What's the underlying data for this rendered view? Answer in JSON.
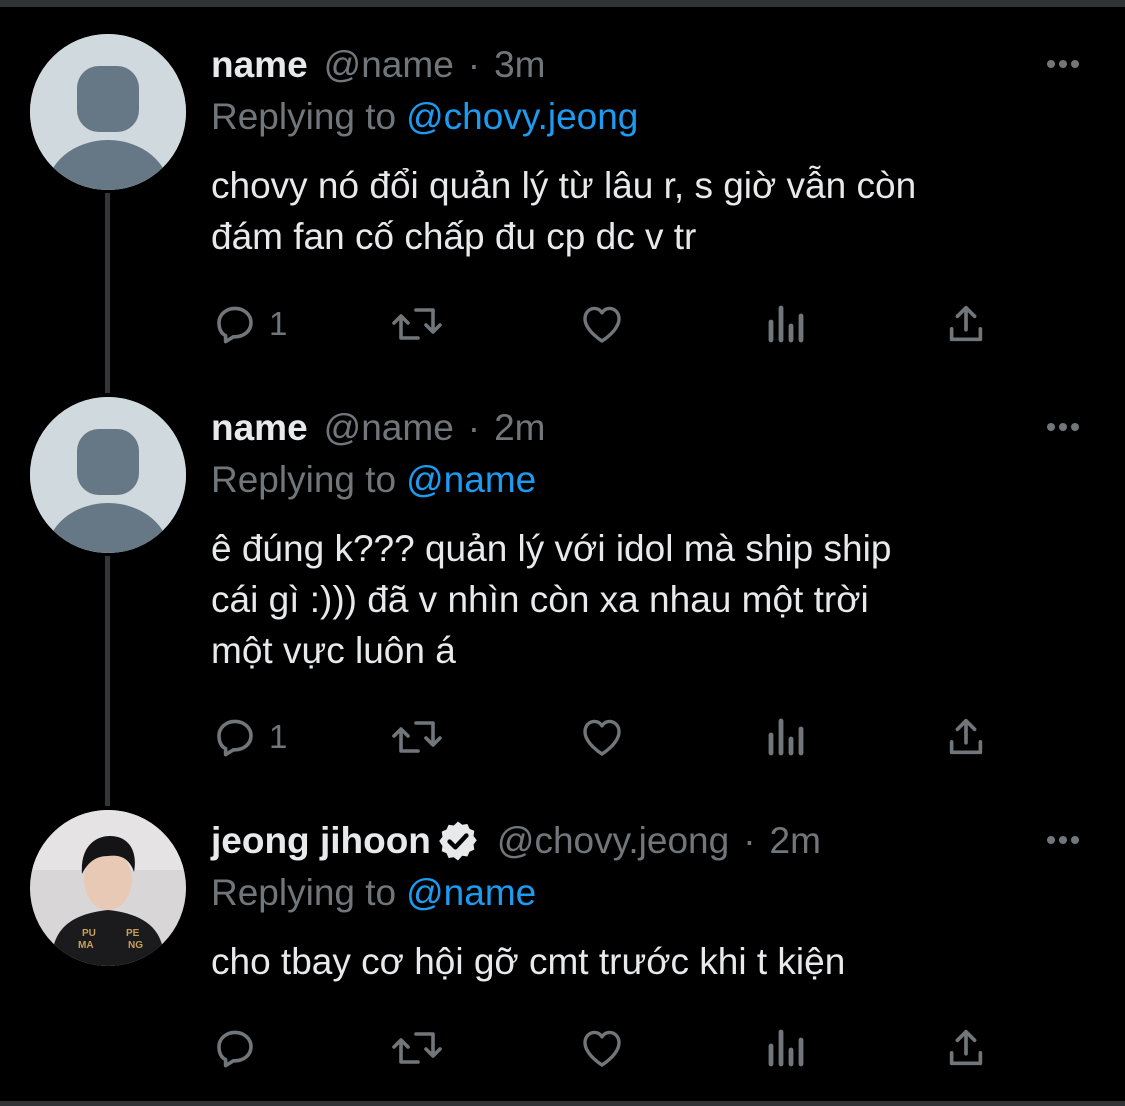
{
  "tweets": [
    {
      "display_name": "name",
      "handle": "@name",
      "dot": "·",
      "time": "3m",
      "replying_prefix": "Replying to",
      "replying_to": "@chovy.jeong",
      "text": "chovy nó đổi quản lý từ lâu r, s giờ vẫn còn\nđám fan cố chấp đu cp dc v tr",
      "reply_count": "1",
      "avatar": "default-avatar",
      "verified": false
    },
    {
      "display_name": "name",
      "handle": "@name",
      "dot": "·",
      "time": "2m",
      "replying_prefix": "Replying to",
      "replying_to": "@name",
      "text": "ê đúng k??? quản lý với idol mà ship ship\ncái gì :))) đã v nhìn còn xa nhau một trời\nmột vực luôn á",
      "reply_count": "1",
      "avatar": "default-avatar",
      "verified": false
    },
    {
      "display_name": "jeong jihoon",
      "handle": "@chovy.jeong",
      "dot": "·",
      "time": "2m",
      "replying_prefix": "Replying to",
      "replying_to": "@name",
      "text": "cho tbay cơ hội gỡ cmt trước khi t kiện",
      "reply_count": "",
      "avatar": "profile-photo",
      "verified": true
    }
  ],
  "icons": [
    "more-icon",
    "reply-icon",
    "retweet-icon",
    "like-icon",
    "views-icon",
    "share-icon",
    "verified-badge-icon"
  ],
  "colors": {
    "background": "#000000",
    "text": "#e7e9ea",
    "secondary": "#71767b",
    "link": "#1d9bf0",
    "thread_line": "#333639"
  }
}
